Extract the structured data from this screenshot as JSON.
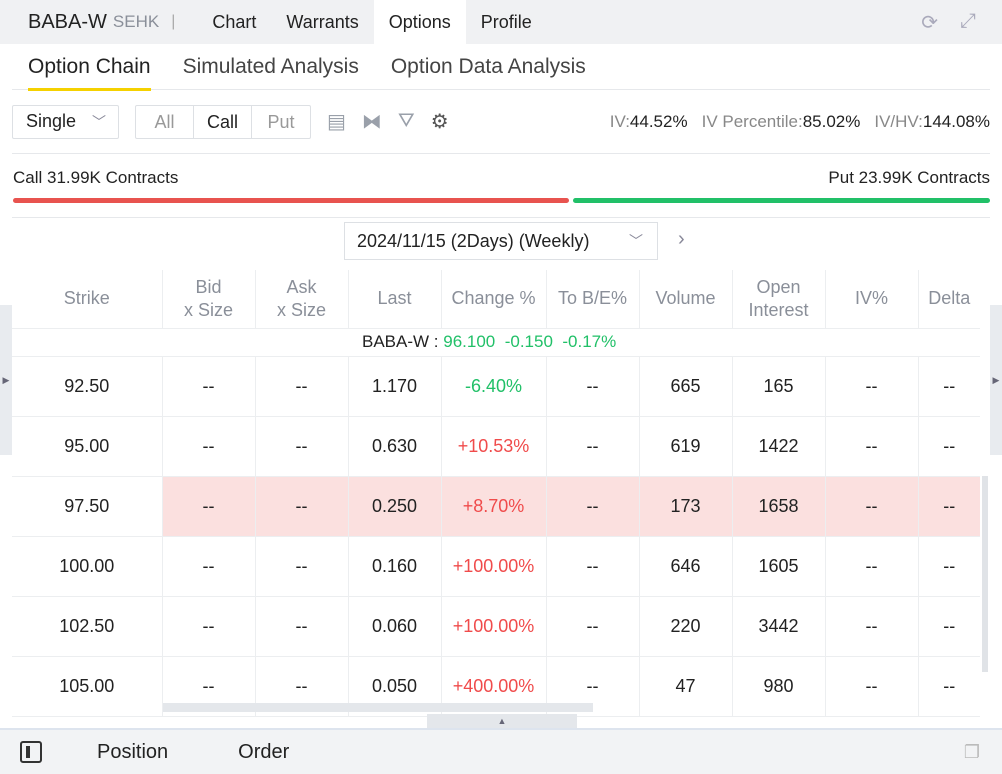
{
  "header": {
    "symbol": "BABA-W",
    "exchange": "SEHK",
    "tabs": [
      "Chart",
      "Warrants",
      "Options",
      "Profile"
    ],
    "active_tab": "Options"
  },
  "subtabs": [
    "Option Chain",
    "Simulated Analysis",
    "Option Data Analysis"
  ],
  "toolbar": {
    "strategy": "Single",
    "filters": [
      "All",
      "Call",
      "Put"
    ],
    "active_filter": "Call",
    "iv_label": "IV:",
    "iv": "44.52%",
    "ivp_label": "IV Percentile:",
    "ivp": "85.02%",
    "ivhv_label": "IV/HV:",
    "ivhv": "144.08%"
  },
  "contracts": {
    "call": "Call 31.99K Contracts",
    "put": "Put 23.99K Contracts",
    "call_fraction": 0.571
  },
  "expiry": "2024/11/15 (2Days) (Weekly)",
  "columns": [
    [
      "Strike"
    ],
    [
      "Bid",
      "x Size"
    ],
    [
      "Ask",
      "x Size"
    ],
    [
      "Last"
    ],
    [
      "Change %"
    ],
    [
      "To B/E%"
    ],
    [
      "Volume"
    ],
    [
      "Open",
      "Interest"
    ],
    [
      "IV%"
    ],
    [
      "Delta"
    ]
  ],
  "underlying": {
    "name": "BABA-W :",
    "price": "96.100",
    "change": "-0.150",
    "pct": "-0.17%"
  },
  "rows": [
    [
      "92.50",
      "--",
      "--",
      "1.170",
      "-6.40%",
      "--",
      "665",
      "165",
      "--",
      "--"
    ],
    [
      "95.00",
      "--",
      "--",
      "0.630",
      "+10.53%",
      "--",
      "619",
      "1422",
      "--",
      "--"
    ],
    [
      "97.50",
      "--",
      "--",
      "0.250",
      "+8.70%",
      "--",
      "173",
      "1658",
      "--",
      "--"
    ],
    [
      "100.00",
      "--",
      "--",
      "0.160",
      "+100.00%",
      "--",
      "646",
      "1605",
      "--",
      "--"
    ],
    [
      "102.50",
      "--",
      "--",
      "0.060",
      "+100.00%",
      "--",
      "220",
      "3442",
      "--",
      "--"
    ],
    [
      "105.00",
      "--",
      "--",
      "0.050",
      "+400.00%",
      "--",
      "47",
      "980",
      "--",
      "--"
    ]
  ],
  "highlight_row": 2,
  "bottom": {
    "tabs": [
      "Position",
      "Order"
    ]
  },
  "colors": {
    "up": "#f04b4b",
    "down": "#21c068",
    "accent": "#f5d100"
  }
}
